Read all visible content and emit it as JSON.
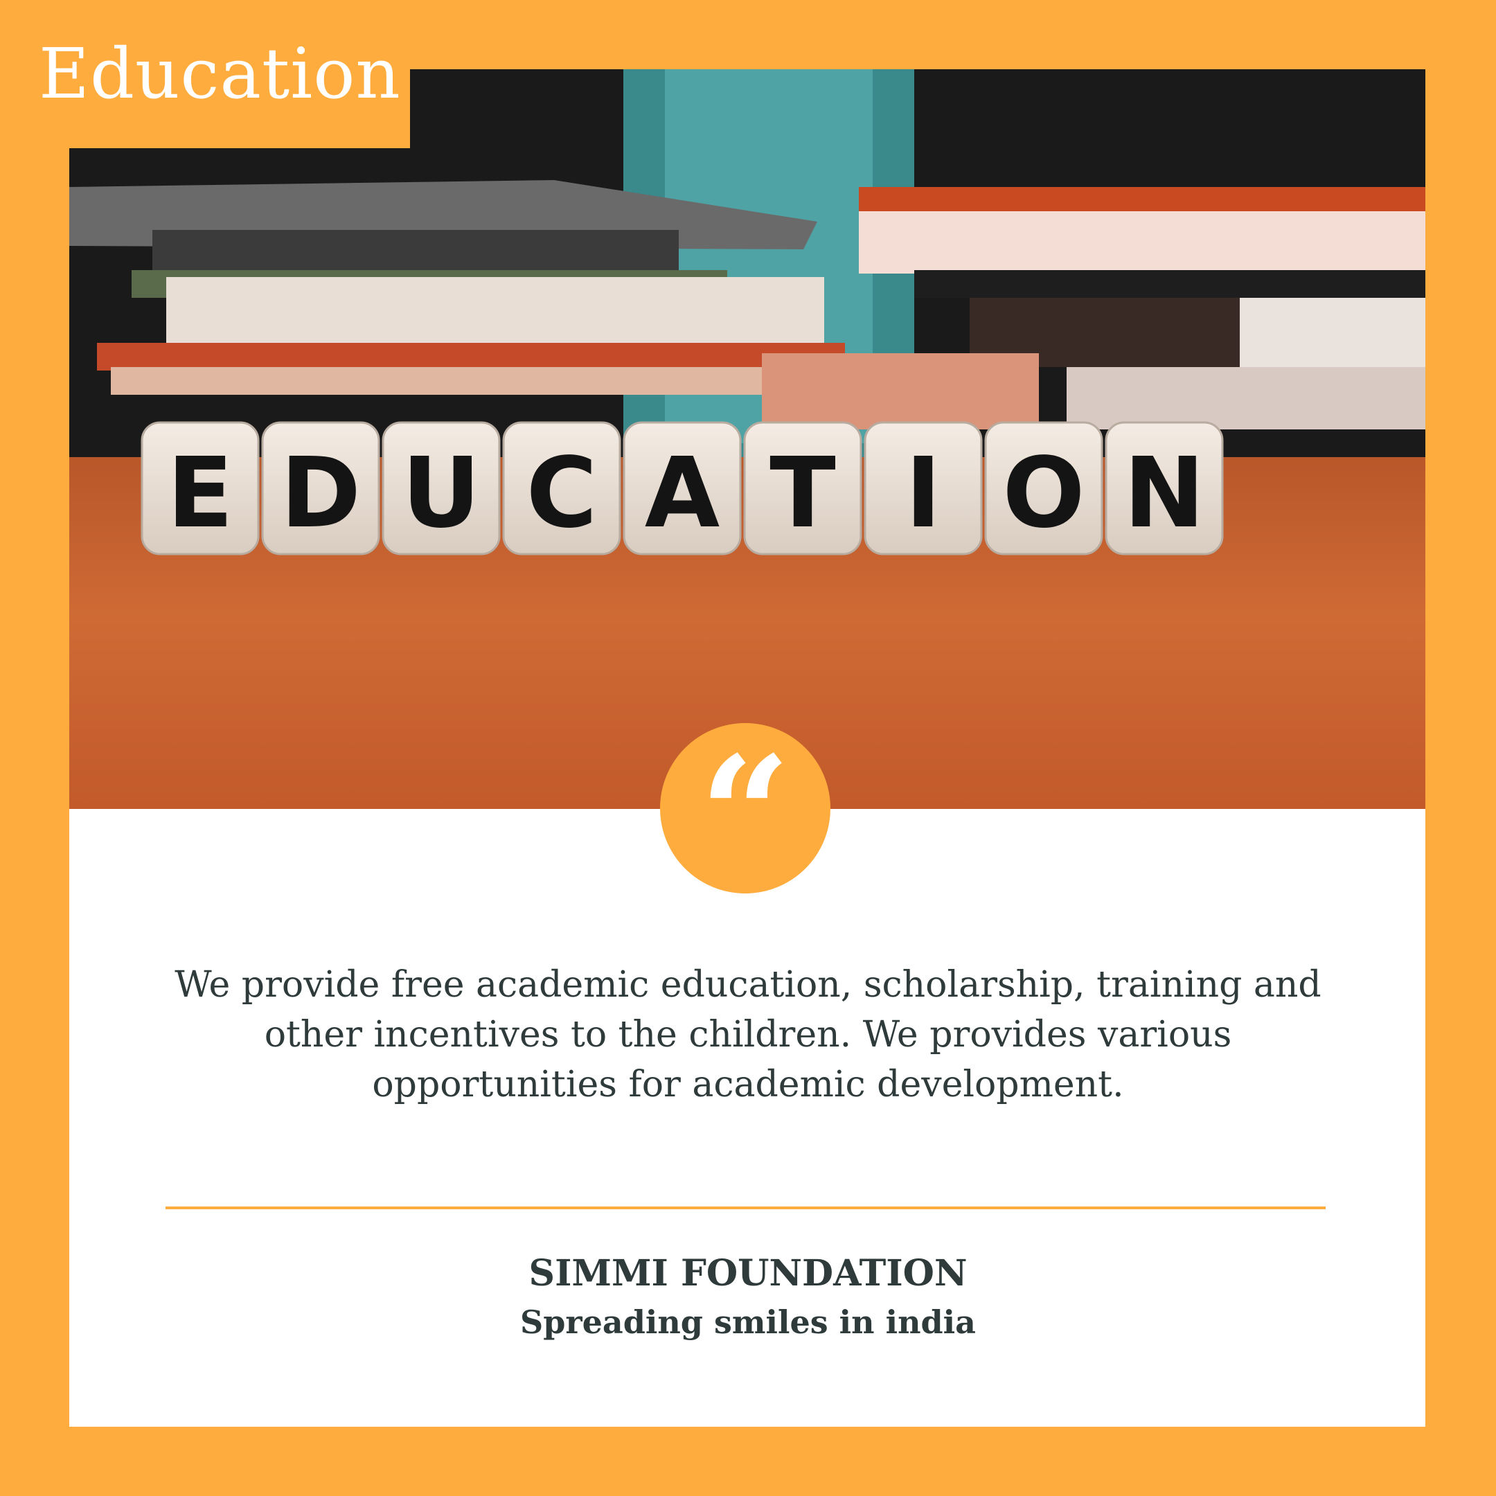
{
  "header": {
    "tag_label": "Education"
  },
  "hero_image": {
    "cube_letters": [
      "E",
      "D",
      "U",
      "C",
      "A",
      "T",
      "I",
      "O",
      "N"
    ]
  },
  "quote": {
    "icon": "quote-open-icon",
    "glyph": "“",
    "text": "We provide free academic education, scholarship, training and other incentives to the children. We provides various opportunities for academic development."
  },
  "footer": {
    "org_name": "SIMMI FOUNDATION",
    "tagline": "Spreading smiles in india"
  },
  "colors": {
    "accent": "#FFAC3E",
    "text": "#2f3b3b",
    "card": "#ffffff"
  }
}
